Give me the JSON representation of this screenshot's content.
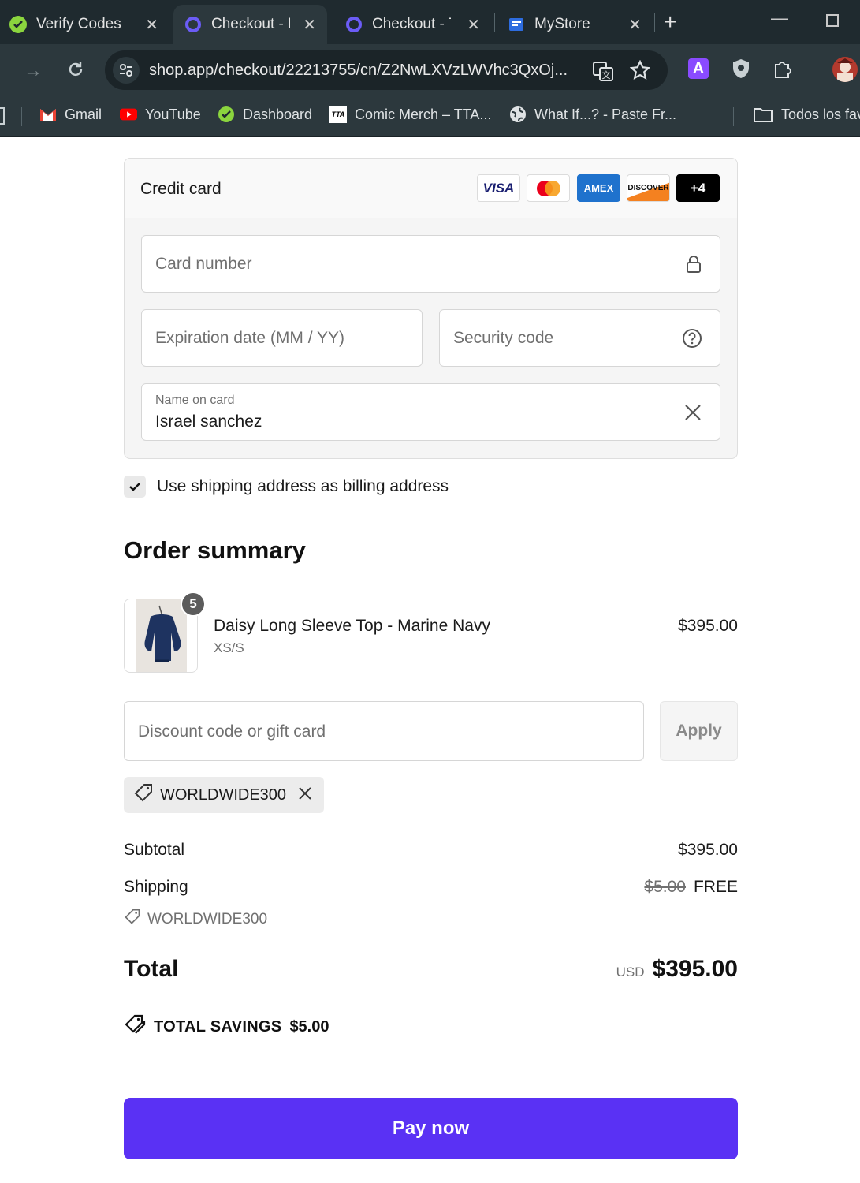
{
  "browser": {
    "tabs": [
      {
        "title": "Verify Codes",
        "icon": "verify-check-icon"
      },
      {
        "title": "Checkout - L",
        "icon": "shop-icon"
      },
      {
        "title": "Checkout - T",
        "icon": "shop-icon"
      },
      {
        "title": "MyStore",
        "icon": "store-icon"
      }
    ],
    "url": "shop.app/checkout/22213755/cn/Z2NwLXVzLWVhc3QxOj...",
    "bookmarks": [
      {
        "label": "Gmail",
        "icon": "gmail-icon"
      },
      {
        "label": "YouTube",
        "icon": "youtube-icon"
      },
      {
        "label": "Dashboard",
        "icon": "dashboard-icon"
      },
      {
        "label": "Comic Merch – TTA...",
        "icon": "tta-icon"
      },
      {
        "label": "What If...? - Paste Fr...",
        "icon": "globe-icon"
      },
      {
        "label": "Todos los fav",
        "icon": "folder-icon"
      }
    ],
    "extension_letter": "A"
  },
  "payment": {
    "title": "Credit card",
    "brands": [
      "VISA",
      "Mastercard",
      "AMEX",
      "DISCOVER",
      "+4"
    ],
    "card_number_placeholder": "Card number",
    "expiration_placeholder": "Expiration date (MM / YY)",
    "security_placeholder": "Security code",
    "name_label": "Name on card",
    "name_value": "Israel sanchez"
  },
  "billing": {
    "checked": true,
    "label": "Use shipping address as billing address"
  },
  "summary": {
    "heading": "Order summary",
    "item": {
      "quantity": "5",
      "name": "Daisy Long Sleeve Top - Marine Navy",
      "variant": "XS/S",
      "price": "$395.00"
    },
    "discount_placeholder": "Discount code or gift card",
    "apply_label": "Apply",
    "applied_code": "WORLDWIDE300",
    "subtotal_label": "Subtotal",
    "subtotal_value": "$395.00",
    "shipping_label": "Shipping",
    "shipping_original": "$5.00",
    "shipping_value": "FREE",
    "shipping_code": "WORLDWIDE300",
    "total_label": "Total",
    "total_currency": "USD",
    "total_value": "$395.00",
    "savings_label": "TOTAL SAVINGS",
    "savings_value": "$5.00"
  },
  "pay_button": "Pay now",
  "colors": {
    "pay_button": "#5a31f4",
    "browser_frame": "#1f2a2f",
    "browser_toolbar": "#2c383d"
  }
}
